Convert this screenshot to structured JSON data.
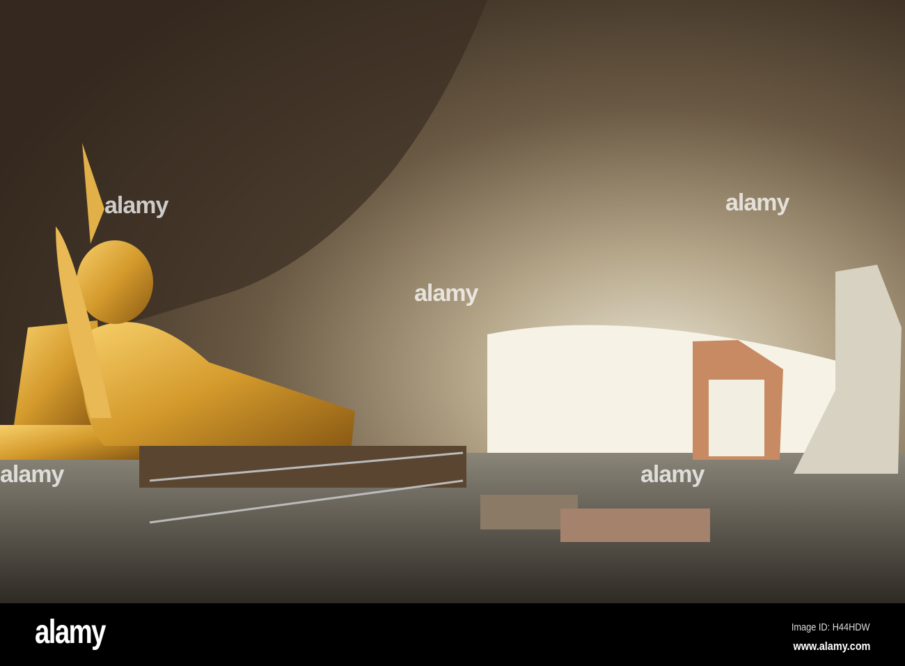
{
  "photo": {
    "subject": "Reclining golden Buddha in cave temple"
  },
  "watermark": {
    "text": "alamy"
  },
  "footer": {
    "logo": "alamy",
    "image_id": "Image ID: H44HDW",
    "url": "www.alamy.com"
  },
  "colors": {
    "gold": "#d49a2c",
    "cave": "#5a4a38",
    "light": "#f4f0e0"
  }
}
